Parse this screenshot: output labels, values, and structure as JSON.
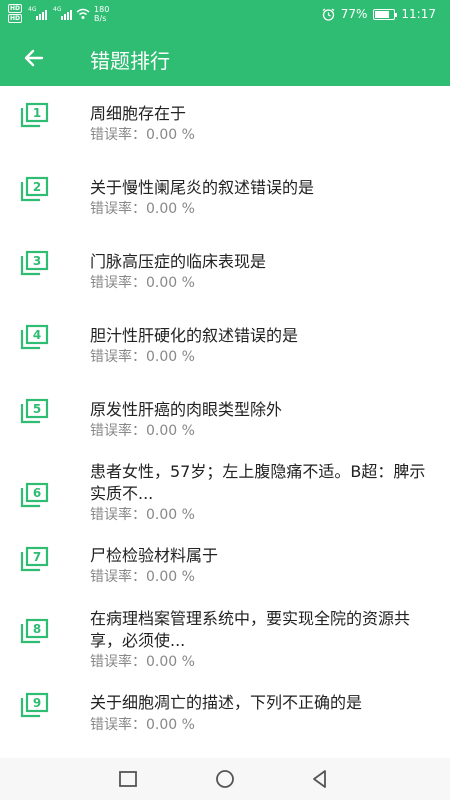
{
  "status_bar": {
    "hd1": "HD",
    "hd2": "HD",
    "net1": "4G",
    "net2": "4G",
    "speed_value": "180",
    "speed_unit": "B/s",
    "battery": "77%",
    "battery_level": 0.77,
    "time": "11:17"
  },
  "header": {
    "title": "错题排行"
  },
  "items": [
    {
      "num": "1",
      "title": "周细胞存在于",
      "rate": "错误率：0.00 %"
    },
    {
      "num": "2",
      "title": "关于慢性阑尾炎的叙述错误的是",
      "rate": "错误率：0.00 %"
    },
    {
      "num": "3",
      "title": "门脉高压症的临床表现是",
      "rate": "错误率：0.00 %"
    },
    {
      "num": "4",
      "title": "胆汁性肝硬化的叙述错误的是",
      "rate": "错误率：0.00 %"
    },
    {
      "num": "5",
      "title": "原发性肝癌的肉眼类型除外",
      "rate": "错误率：0.00 %"
    },
    {
      "num": "6",
      "title": "患者女性，57岁；左上腹隐痛不适。B超：脾示实质不...",
      "rate": "错误率：0.00 %"
    },
    {
      "num": "7",
      "title": "尸检检验材料属于",
      "rate": "错误率：0.00 %"
    },
    {
      "num": "8",
      "title": "在病理档案管理系统中，要实现全院的资源共享，必须使...",
      "rate": "错误率：0.00 %"
    },
    {
      "num": "9",
      "title": "关于细胞凋亡的描述，下列不正确的是",
      "rate": "错误率：0.00 %"
    }
  ],
  "colors": {
    "accent": "#2fbd73",
    "text": "#222222",
    "muted": "#888888"
  }
}
